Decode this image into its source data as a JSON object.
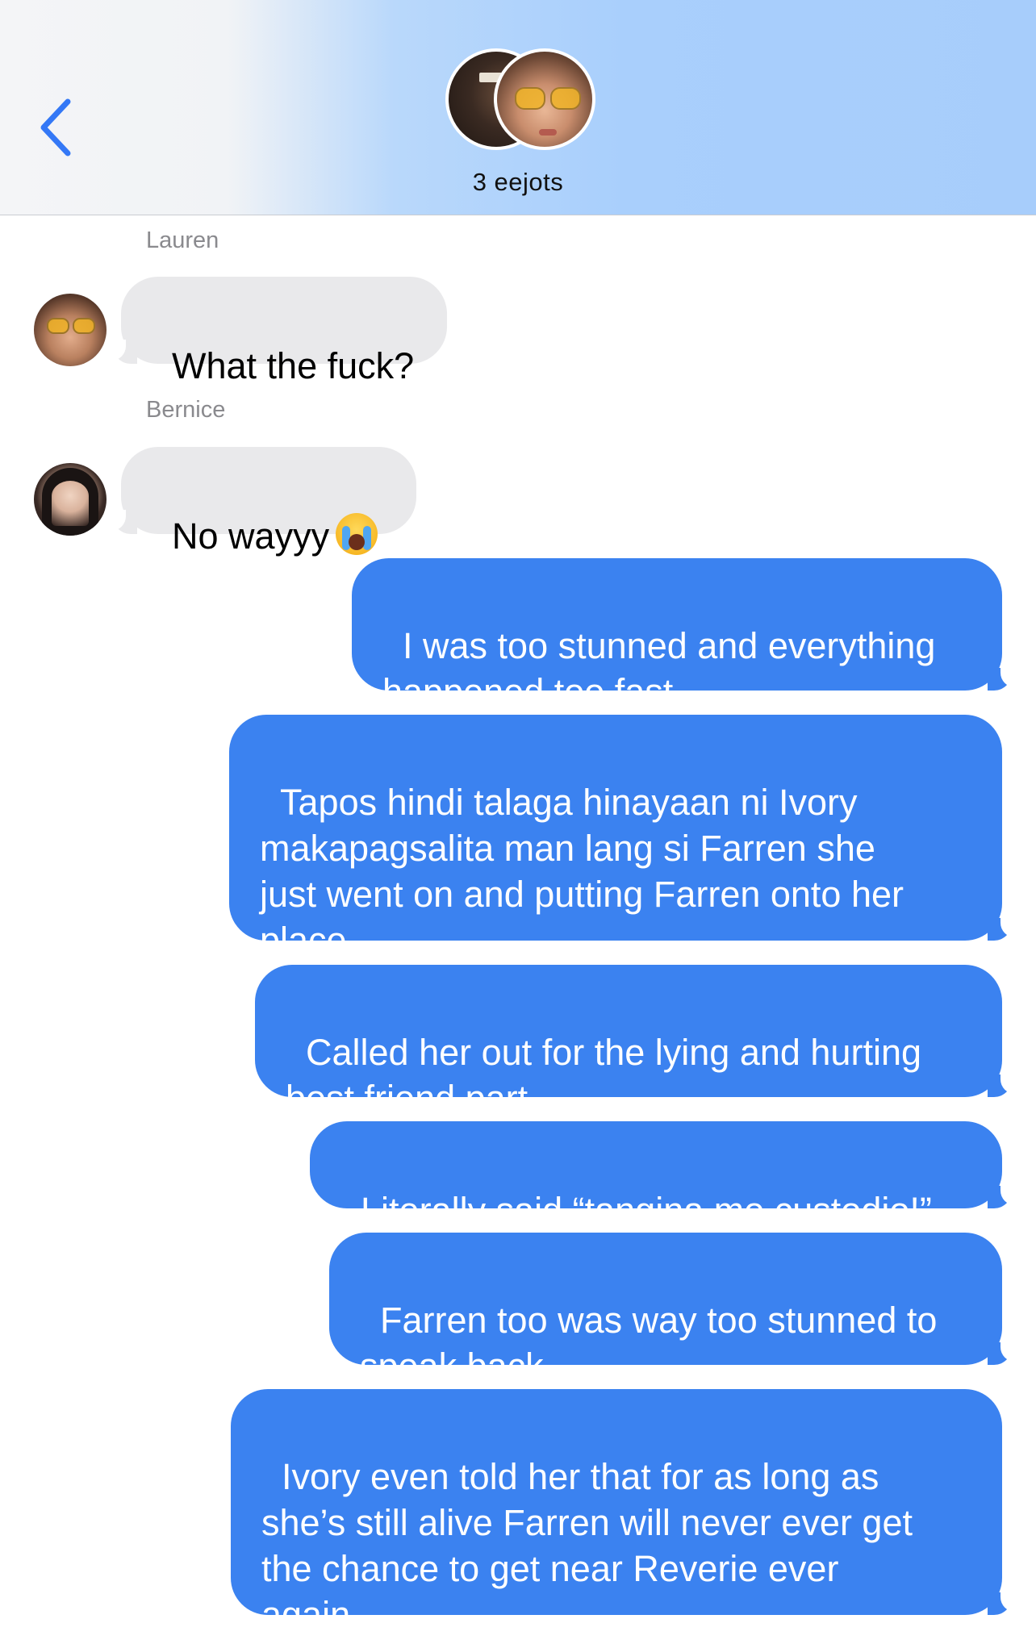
{
  "header": {
    "back_icon": "chevron-left-icon",
    "group_name": "3 eejots",
    "accent_color": "#3478f6"
  },
  "messages": [
    {
      "sender": "Lauren",
      "direction": "incoming",
      "text": "What the fuck?"
    },
    {
      "sender": "Bernice",
      "direction": "incoming",
      "text": "No wayyy",
      "emoji": "loudly-crying-face-emoji"
    },
    {
      "direction": "outgoing",
      "text": "I was too stunned and everything\nhappened too fast"
    },
    {
      "direction": "outgoing",
      "text": "Tapos hindi talaga hinayaan ni Ivory\nmakapagsalita man lang si Farren she\njust went on and putting Farren onto her\nplace"
    },
    {
      "direction": "outgoing",
      "text": "Called her out for the lying and hurting\nbest friend part"
    },
    {
      "direction": "outgoing",
      "text": "Literally said “tangina mo custodio!”"
    },
    {
      "direction": "outgoing",
      "text": "Farren too was way too stunned to\nspeak back"
    },
    {
      "direction": "outgoing",
      "text": "Ivory even told her that for as long as\nshe’s still alive Farren will never ever get\nthe chance to get near Reverie ever\nagain"
    }
  ],
  "colors": {
    "incoming_bubble": "#e9e9eb",
    "outgoing_bubble": "#3b82f0",
    "sender_name": "#8a8a8e"
  }
}
